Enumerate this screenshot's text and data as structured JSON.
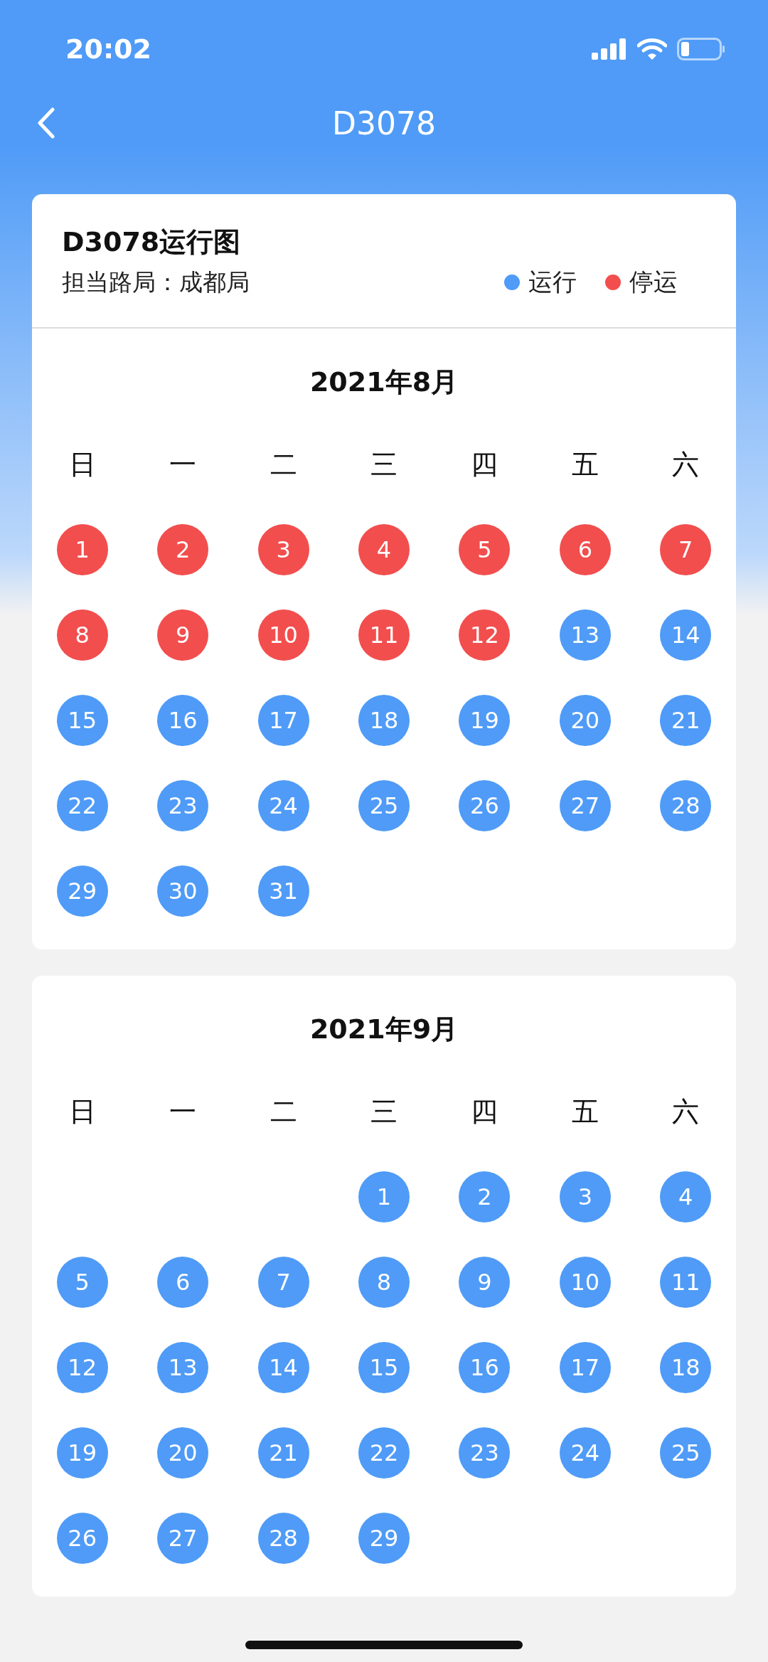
{
  "status_bar": {
    "time": "20:02"
  },
  "nav": {
    "title": "D3078"
  },
  "card_header": {
    "title": "D3078运行图",
    "bureau": "担当路局：成都局"
  },
  "legend": [
    {
      "label": "运行",
      "color": "#4f9bf7"
    },
    {
      "label": "停运",
      "color": "#f24e4e"
    }
  ],
  "months": [
    {
      "title": "2021年8月",
      "weekdays": [
        "日",
        "一",
        "二",
        "三",
        "四",
        "五",
        "六"
      ],
      "weeks": [
        [
          {
            "kind": "day",
            "day": "1",
            "color": "#f24e4e"
          },
          {
            "kind": "day",
            "day": "2",
            "color": "#f24e4e"
          },
          {
            "kind": "day",
            "day": "3",
            "color": "#f24e4e"
          },
          {
            "kind": "day",
            "day": "4",
            "color": "#f24e4e"
          },
          {
            "kind": "day",
            "day": "5",
            "color": "#f24e4e"
          },
          {
            "kind": "day",
            "day": "6",
            "color": "#f24e4e"
          },
          {
            "kind": "day",
            "day": "7",
            "color": "#f24e4e"
          }
        ],
        [
          {
            "kind": "day",
            "day": "8",
            "color": "#f24e4e"
          },
          {
            "kind": "day",
            "day": "9",
            "color": "#f24e4e"
          },
          {
            "kind": "day",
            "day": "10",
            "color": "#f24e4e"
          },
          {
            "kind": "day",
            "day": "11",
            "color": "#f24e4e"
          },
          {
            "kind": "day",
            "day": "12",
            "color": "#f24e4e"
          },
          {
            "kind": "day",
            "day": "13",
            "color": "#4f9bf7"
          },
          {
            "kind": "day",
            "day": "14",
            "color": "#4f9bf7"
          }
        ],
        [
          {
            "kind": "day",
            "day": "15",
            "color": "#4f9bf7"
          },
          {
            "kind": "day",
            "day": "16",
            "color": "#4f9bf7"
          },
          {
            "kind": "day",
            "day": "17",
            "color": "#4f9bf7"
          },
          {
            "kind": "day",
            "day": "18",
            "color": "#4f9bf7"
          },
          {
            "kind": "day",
            "day": "19",
            "color": "#4f9bf7"
          },
          {
            "kind": "day",
            "day": "20",
            "color": "#4f9bf7"
          },
          {
            "kind": "day",
            "day": "21",
            "color": "#4f9bf7"
          }
        ],
        [
          {
            "kind": "day",
            "day": "22",
            "color": "#4f9bf7"
          },
          {
            "kind": "day",
            "day": "23",
            "color": "#4f9bf7"
          },
          {
            "kind": "day",
            "day": "24",
            "color": "#4f9bf7"
          },
          {
            "kind": "day",
            "day": "25",
            "color": "#4f9bf7"
          },
          {
            "kind": "day",
            "day": "26",
            "color": "#4f9bf7"
          },
          {
            "kind": "day",
            "day": "27",
            "color": "#4f9bf7"
          },
          {
            "kind": "day",
            "day": "28",
            "color": "#4f9bf7"
          }
        ],
        [
          {
            "kind": "day",
            "day": "29",
            "color": "#4f9bf7"
          },
          {
            "kind": "day",
            "day": "30",
            "color": "#4f9bf7"
          },
          {
            "kind": "day",
            "day": "31",
            "color": "#4f9bf7"
          }
        ]
      ]
    },
    {
      "title": "2021年9月",
      "weekdays": [
        "日",
        "一",
        "二",
        "三",
        "四",
        "五",
        "六"
      ],
      "weeks": [
        [
          {
            "kind": "blank"
          },
          {
            "kind": "blank"
          },
          {
            "kind": "blank"
          },
          {
            "kind": "day",
            "day": "1",
            "color": "#4f9bf7"
          },
          {
            "kind": "day",
            "day": "2",
            "color": "#4f9bf7"
          },
          {
            "kind": "day",
            "day": "3",
            "color": "#4f9bf7"
          },
          {
            "kind": "day",
            "day": "4",
            "color": "#4f9bf7"
          }
        ],
        [
          {
            "kind": "day",
            "day": "5",
            "color": "#4f9bf7"
          },
          {
            "kind": "day",
            "day": "6",
            "color": "#4f9bf7"
          },
          {
            "kind": "day",
            "day": "7",
            "color": "#4f9bf7"
          },
          {
            "kind": "day",
            "day": "8",
            "color": "#4f9bf7"
          },
          {
            "kind": "day",
            "day": "9",
            "color": "#4f9bf7"
          },
          {
            "kind": "day",
            "day": "10",
            "color": "#4f9bf7"
          },
          {
            "kind": "day",
            "day": "11",
            "color": "#4f9bf7"
          }
        ],
        [
          {
            "kind": "day",
            "day": "12",
            "color": "#4f9bf7"
          },
          {
            "kind": "day",
            "day": "13",
            "color": "#4f9bf7"
          },
          {
            "kind": "day",
            "day": "14",
            "color": "#4f9bf7"
          },
          {
            "kind": "day",
            "day": "15",
            "color": "#4f9bf7"
          },
          {
            "kind": "day",
            "day": "16",
            "color": "#4f9bf7"
          },
          {
            "kind": "day",
            "day": "17",
            "color": "#4f9bf7"
          },
          {
            "kind": "day",
            "day": "18",
            "color": "#4f9bf7"
          }
        ],
        [
          {
            "kind": "day",
            "day": "19",
            "color": "#4f9bf7"
          },
          {
            "kind": "day",
            "day": "20",
            "color": "#4f9bf7"
          },
          {
            "kind": "day",
            "day": "21",
            "color": "#4f9bf7"
          },
          {
            "kind": "day",
            "day": "22",
            "color": "#4f9bf7"
          },
          {
            "kind": "day",
            "day": "23",
            "color": "#4f9bf7"
          },
          {
            "kind": "day",
            "day": "24",
            "color": "#4f9bf7"
          },
          {
            "kind": "day",
            "day": "25",
            "color": "#4f9bf7"
          }
        ],
        [
          {
            "kind": "day",
            "day": "26",
            "color": "#4f9bf7"
          },
          {
            "kind": "day",
            "day": "27",
            "color": "#4f9bf7"
          },
          {
            "kind": "day",
            "day": "28",
            "color": "#4f9bf7"
          },
          {
            "kind": "day",
            "day": "29",
            "color": "#4f9bf7"
          }
        ]
      ]
    }
  ]
}
